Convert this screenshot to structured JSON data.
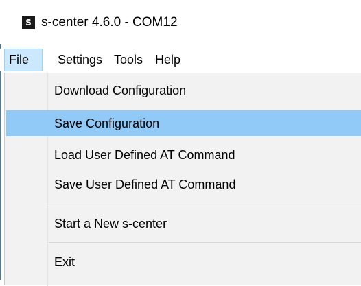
{
  "window": {
    "app_icon_letter": "S",
    "title": "s-center 4.6.0 - COM12"
  },
  "menubar": {
    "items": [
      {
        "label": "File",
        "active": true
      },
      {
        "label": "Settings"
      },
      {
        "label": "Tools"
      },
      {
        "label": "Help"
      }
    ]
  },
  "file_menu": {
    "items": [
      {
        "label": "Download Configuration"
      },
      {
        "label": "Save Configuration",
        "highlighted": true
      },
      {
        "label": "Load User Defined AT Command"
      },
      {
        "label": "Save User Defined AT Command"
      },
      {
        "label": "Start a New s-center"
      },
      {
        "label": "Exit"
      }
    ]
  },
  "colors": {
    "highlight": "#91c9f7",
    "active_menu": "#cce8ff",
    "menu_background": "#f2f2f2"
  }
}
